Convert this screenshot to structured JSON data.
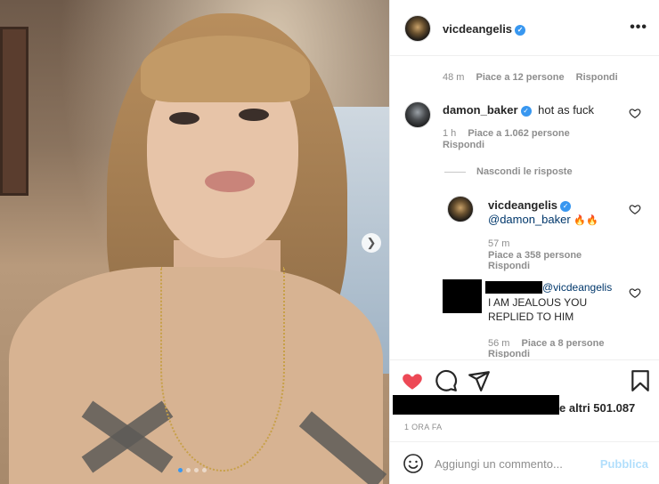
{
  "post": {
    "author": "vicdeangelis",
    "more_icon": "more-horizontal-icon",
    "carousel": {
      "slides": 4,
      "active_index": 0
    }
  },
  "comments": [
    {
      "id": "prev",
      "time": "48 m",
      "likes": "Piace a 12 persone",
      "reply": "Rispondi"
    },
    {
      "id": "damon",
      "username": "damon_baker",
      "text": "hot as fuck",
      "time": "1 h",
      "likes": "Piace a 1.062 persone",
      "reply": "Rispondi",
      "hide_replies": "Nascondi le risposte"
    },
    {
      "id": "vic-reply",
      "username": "vicdeangelis",
      "mention": "@damon_baker",
      "emoji": "🔥🔥",
      "time": "57 m",
      "likes": "Piace a 358 persone",
      "reply": "Rispondi"
    },
    {
      "id": "redacted-reply",
      "mention": "@vicdeangelis",
      "text_line1": "I AM JEALOUS YOU",
      "text_line2": "REPLIED TO HIM",
      "time": "56 m",
      "likes": "Piace a 8 persone",
      "reply": "Rispondi"
    }
  ],
  "likes_summary": "e altri 501.087",
  "posted_time": "1 ORA FA",
  "composer": {
    "placeholder": "Aggiungi un commento...",
    "post_label": "Pubblica"
  },
  "colors": {
    "like_red": "#ed4956",
    "verified_blue": "#3897f0",
    "publish_disabled": "#b2dffc"
  }
}
